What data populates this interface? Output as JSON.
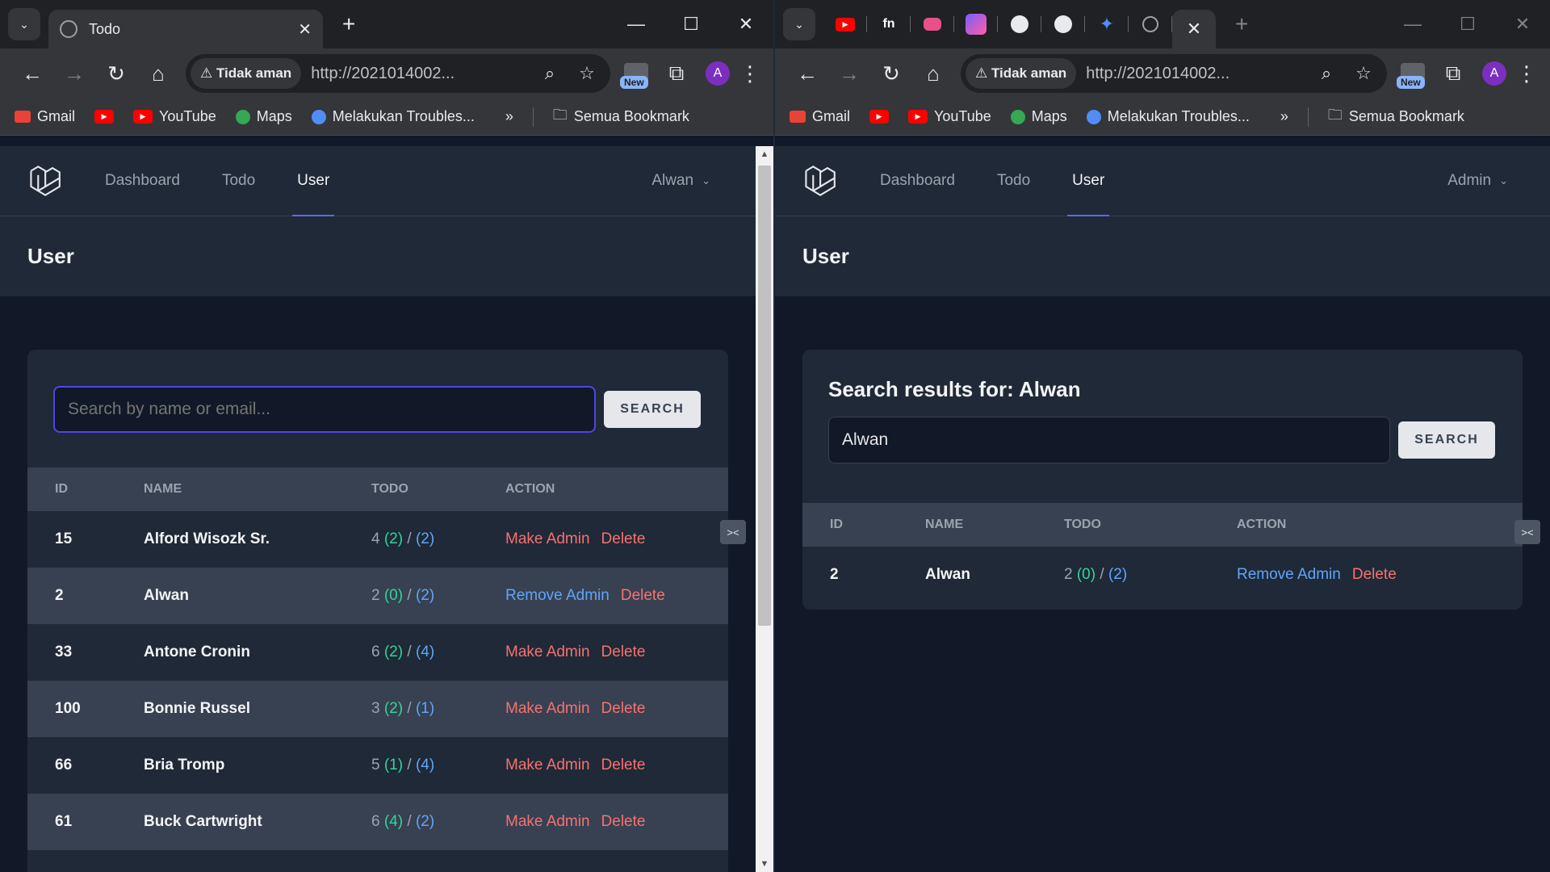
{
  "left": {
    "tab_title": "Todo",
    "security": "Tidak aman",
    "url": "http://2021014002...",
    "new_badge": "New",
    "avatar": "A",
    "bookmarks": [
      "Gmail",
      "YouTube",
      "Maps",
      "Melakukan Troubles...",
      "Semua Bookmark"
    ],
    "nav": {
      "dashboard": "Dashboard",
      "todo": "Todo",
      "user": "User",
      "account": "Alwan"
    },
    "page_title": "User",
    "search": {
      "placeholder": "Search by name or email...",
      "button": "SEARCH"
    },
    "table": {
      "headers": [
        "ID",
        "NAME",
        "TODO",
        "ACTION"
      ],
      "rows": [
        {
          "id": "15",
          "name": "Alford Wisozk Sr.",
          "total": "4",
          "done": "(2)",
          "pending": "(2)",
          "action": "Make Admin",
          "delete": "Delete"
        },
        {
          "id": "2",
          "name": "Alwan",
          "total": "2",
          "done": "(0)",
          "pending": "(2)",
          "action": "Remove Admin",
          "delete": "Delete"
        },
        {
          "id": "33",
          "name": "Antone Cronin",
          "total": "6",
          "done": "(2)",
          "pending": "(4)",
          "action": "Make Admin",
          "delete": "Delete"
        },
        {
          "id": "100",
          "name": "Bonnie Russel",
          "total": "3",
          "done": "(2)",
          "pending": "(1)",
          "action": "Make Admin",
          "delete": "Delete"
        },
        {
          "id": "66",
          "name": "Bria Tromp",
          "total": "5",
          "done": "(1)",
          "pending": "(4)",
          "action": "Make Admin",
          "delete": "Delete"
        },
        {
          "id": "61",
          "name": "Buck Cartwright",
          "total": "6",
          "done": "(4)",
          "pending": "(2)",
          "action": "Make Admin",
          "delete": "Delete"
        }
      ]
    }
  },
  "right": {
    "security": "Tidak aman",
    "url": "http://2021014002...",
    "new_badge": "New",
    "avatar": "A",
    "bookmarks": [
      "Gmail",
      "YouTube",
      "Maps",
      "Melakukan Troubles...",
      "Semua Bookmark"
    ],
    "nav": {
      "dashboard": "Dashboard",
      "todo": "Todo",
      "user": "User",
      "account": "Admin"
    },
    "page_title": "User",
    "results_heading": "Search results for: Alwan",
    "search": {
      "value": "Alwan",
      "button": "SEARCH"
    },
    "table": {
      "headers": [
        "ID",
        "NAME",
        "TODO",
        "ACTION"
      ],
      "rows": [
        {
          "id": "2",
          "name": "Alwan",
          "total": "2",
          "done": "(0)",
          "pending": "(2)",
          "action": "Remove Admin",
          "delete": "Delete"
        }
      ]
    }
  },
  "separator": "/",
  "icons": [
    "tab-search-icon",
    "globe-icon",
    "close-icon",
    "new-tab-icon",
    "minimize-icon",
    "maximize-icon",
    "back-icon",
    "forward-icon",
    "reload-icon",
    "home-icon",
    "warning-icon",
    "zoom-icon",
    "star-icon",
    "extensions-icon",
    "menu-icon",
    "folder-icon",
    "laravel-logo-icon",
    "chevron-down-icon",
    "debugbar-icon"
  ],
  "colors": {
    "accent": "#6366f1",
    "green": "#34d399",
    "blue": "#60a5fa",
    "red": "#f87171"
  }
}
